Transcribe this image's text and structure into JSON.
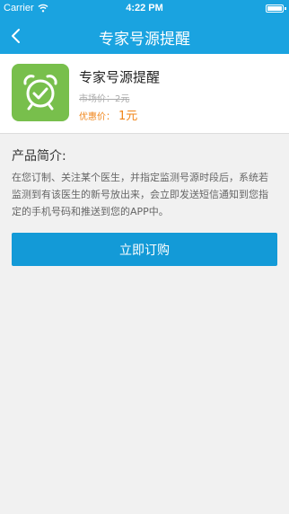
{
  "status_bar": {
    "carrier": "Carrier",
    "time": "4:22 PM"
  },
  "nav": {
    "title": "专家号源提醒",
    "back_icon": "chevron-left-icon"
  },
  "product": {
    "icon": "alarm-clock-check-icon",
    "icon_color": "#78bf4c",
    "name": "专家号源提醒",
    "market_price": "市场价：2元",
    "sale_label": "优惠价：",
    "sale_value": "1元"
  },
  "intro": {
    "title": "产品简介:",
    "text": "在您订制、关注某个医生，并指定监测号源时段后，系统若监测到有该医生的新号放出来，会立即发送短信通知到您指定的手机号码和推送到您的APP中。"
  },
  "buy_button": {
    "label": "立即订购"
  },
  "colors": {
    "header": "#1aa3e0",
    "button": "#139ad7",
    "price_accent": "#f08519",
    "background": "#f1f1f1"
  }
}
